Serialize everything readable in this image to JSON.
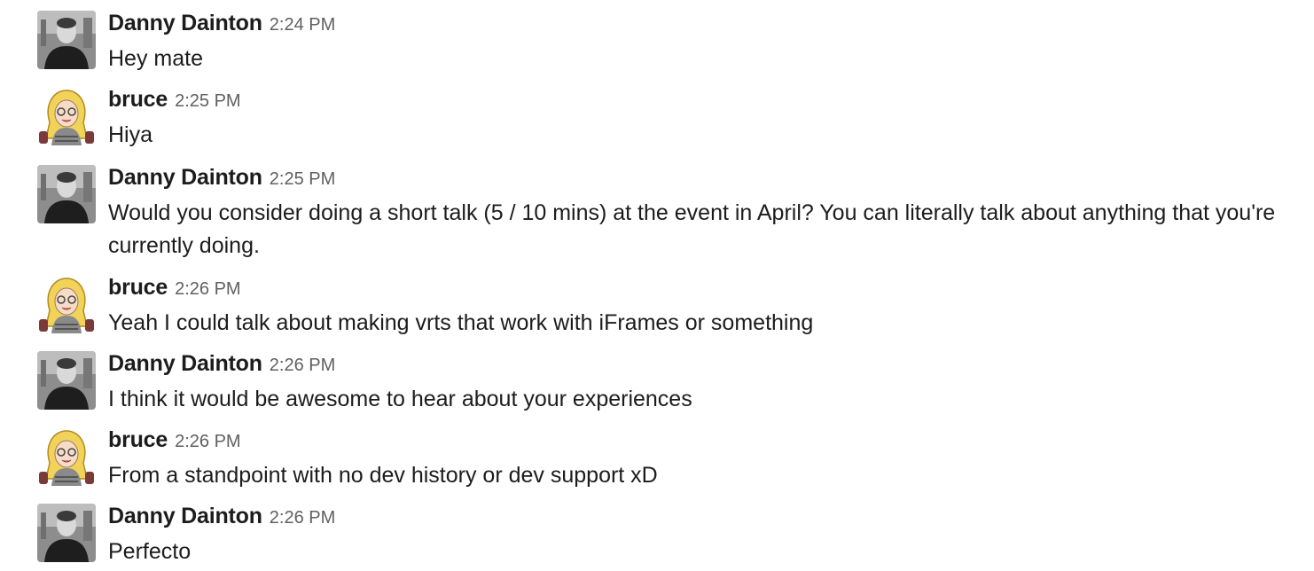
{
  "messages": [
    {
      "author": "Danny Dainton",
      "time": "2:24 PM",
      "text": "Hey mate",
      "avatar": "danny-avatar"
    },
    {
      "author": "bruce",
      "time": "2:25 PM",
      "text": "Hiya",
      "avatar": "bruce-avatar"
    },
    {
      "author": "Danny Dainton",
      "time": "2:25 PM",
      "text": "Would you consider doing a short talk (5 / 10 mins) at the event in April? You can literally talk about anything that you're currently doing.",
      "avatar": "danny-avatar"
    },
    {
      "author": "bruce",
      "time": "2:26 PM",
      "text": "Yeah I could talk about making vrts that work with iFrames or something",
      "avatar": "bruce-avatar"
    },
    {
      "author": "Danny Dainton",
      "time": "2:26 PM",
      "text": "I think it would be awesome to hear about your experiences",
      "avatar": "danny-avatar"
    },
    {
      "author": "bruce",
      "time": "2:26 PM",
      "text": "From a standpoint with no dev history or dev support xD",
      "avatar": "bruce-avatar"
    },
    {
      "author": "Danny Dainton",
      "time": "2:26 PM",
      "text": "Perfecto",
      "avatar": "danny-avatar"
    }
  ],
  "colors": {
    "author": "#1d1c1d",
    "timestamp": "#616061",
    "background": "#ffffff"
  }
}
